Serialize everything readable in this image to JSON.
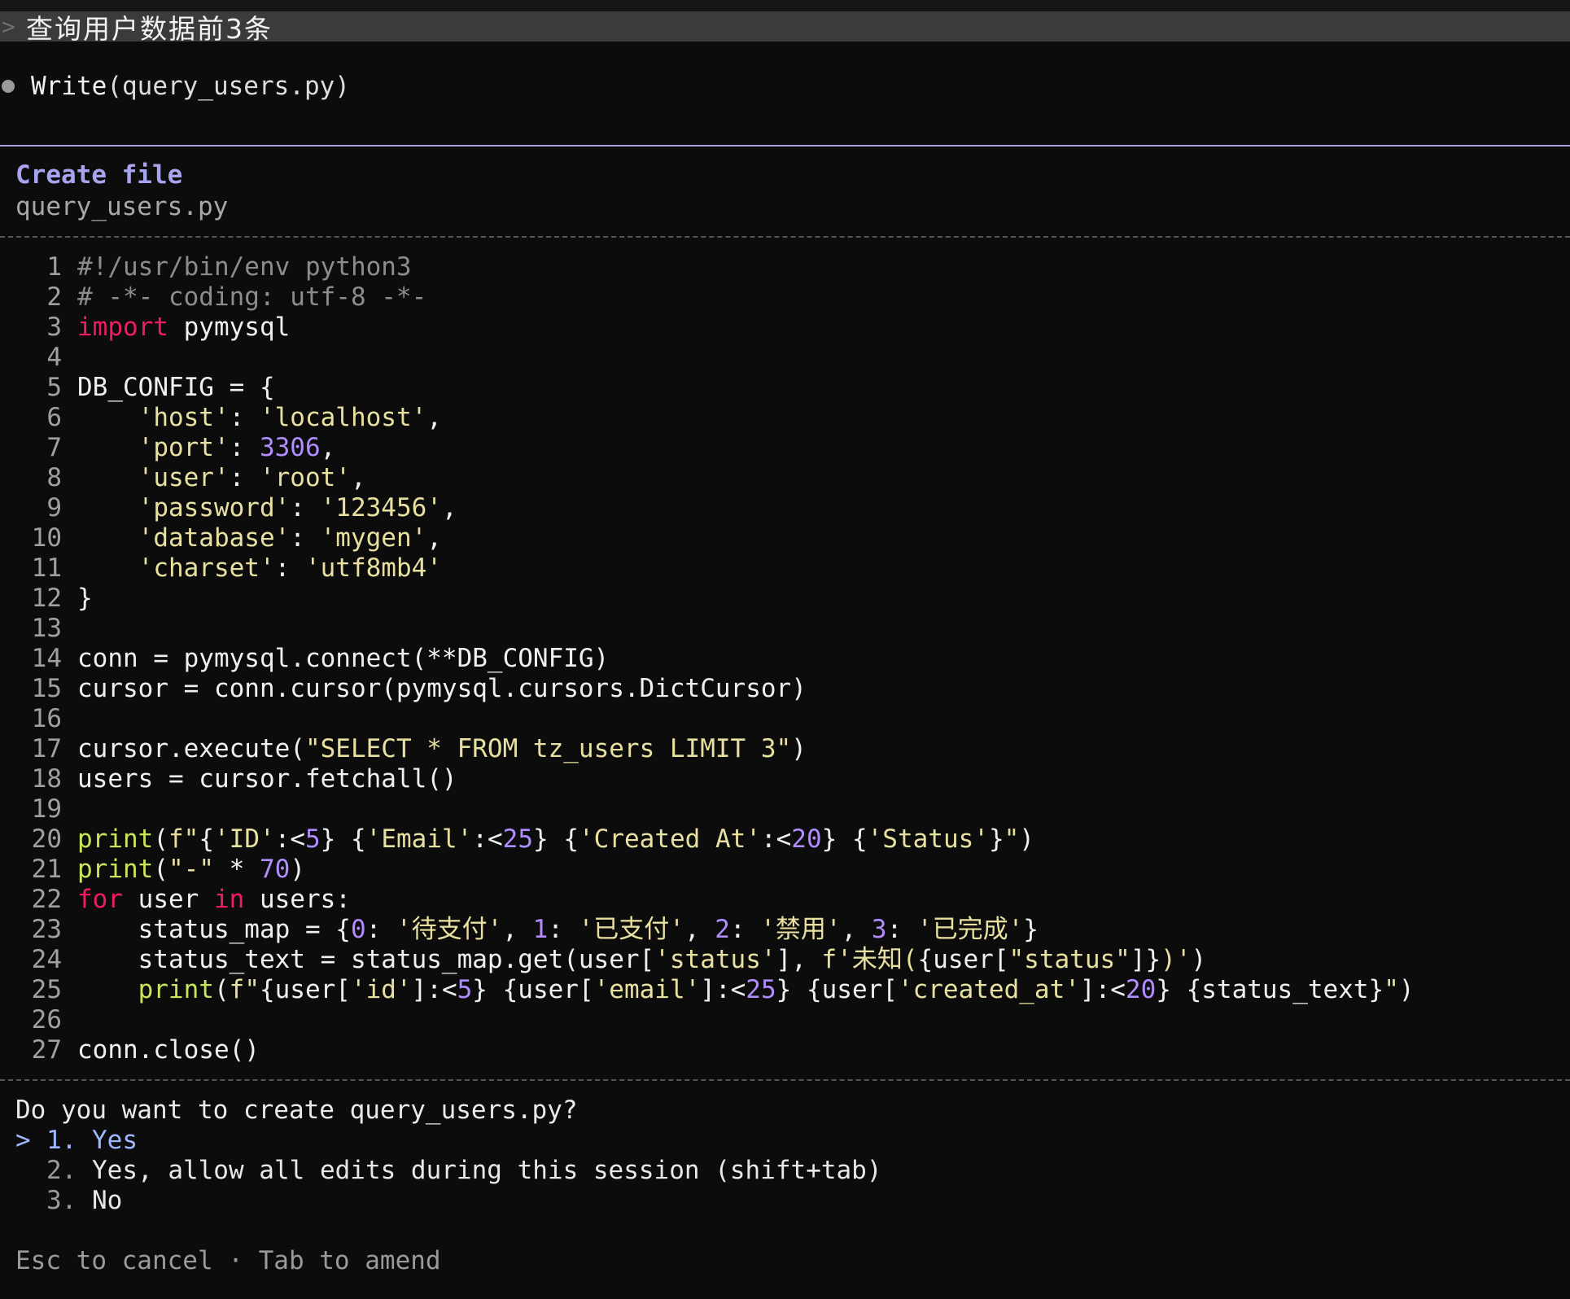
{
  "user_prompt": {
    "caret": ">",
    "message": "查询用户数据前3条"
  },
  "tool_call": {
    "name": "Write",
    "argument": "(query_users.py)"
  },
  "file_panel": {
    "title": "Create file",
    "filename": "query_users.py"
  },
  "code_lines": [
    {
      "n": "1",
      "tokens": [
        {
          "t": "#!/usr/bin/env python3",
          "k": "comment"
        }
      ]
    },
    {
      "n": "2",
      "tokens": [
        {
          "t": "# -*- coding: utf-8 -*-",
          "k": "comment"
        }
      ]
    },
    {
      "n": "3",
      "tokens": [
        {
          "t": "import",
          "k": "keyword"
        },
        {
          "t": " pymysql",
          "k": "plain"
        }
      ]
    },
    {
      "n": "4",
      "tokens": []
    },
    {
      "n": "5",
      "tokens": [
        {
          "t": "DB_CONFIG = {",
          "k": "plain"
        }
      ]
    },
    {
      "n": "6",
      "tokens": [
        {
          "t": "    ",
          "k": "plain"
        },
        {
          "t": "'host'",
          "k": "string"
        },
        {
          "t": ": ",
          "k": "plain"
        },
        {
          "t": "'localhost'",
          "k": "string"
        },
        {
          "t": ",",
          "k": "plain"
        }
      ]
    },
    {
      "n": "7",
      "tokens": [
        {
          "t": "    ",
          "k": "plain"
        },
        {
          "t": "'port'",
          "k": "string"
        },
        {
          "t": ": ",
          "k": "plain"
        },
        {
          "t": "3306",
          "k": "number"
        },
        {
          "t": ",",
          "k": "plain"
        }
      ]
    },
    {
      "n": "8",
      "tokens": [
        {
          "t": "    ",
          "k": "plain"
        },
        {
          "t": "'user'",
          "k": "string"
        },
        {
          "t": ": ",
          "k": "plain"
        },
        {
          "t": "'root'",
          "k": "string"
        },
        {
          "t": ",",
          "k": "plain"
        }
      ]
    },
    {
      "n": "9",
      "tokens": [
        {
          "t": "    ",
          "k": "plain"
        },
        {
          "t": "'password'",
          "k": "string"
        },
        {
          "t": ": ",
          "k": "plain"
        },
        {
          "t": "'123456'",
          "k": "string"
        },
        {
          "t": ",",
          "k": "plain"
        }
      ]
    },
    {
      "n": "10",
      "tokens": [
        {
          "t": "    ",
          "k": "plain"
        },
        {
          "t": "'database'",
          "k": "string"
        },
        {
          "t": ": ",
          "k": "plain"
        },
        {
          "t": "'mygen'",
          "k": "string"
        },
        {
          "t": ",",
          "k": "plain"
        }
      ]
    },
    {
      "n": "11",
      "tokens": [
        {
          "t": "    ",
          "k": "plain"
        },
        {
          "t": "'charset'",
          "k": "string"
        },
        {
          "t": ": ",
          "k": "plain"
        },
        {
          "t": "'utf8mb4'",
          "k": "string"
        }
      ]
    },
    {
      "n": "12",
      "tokens": [
        {
          "t": "}",
          "k": "plain"
        }
      ]
    },
    {
      "n": "13",
      "tokens": []
    },
    {
      "n": "14",
      "tokens": [
        {
          "t": "conn = pymysql.connect(**DB_CONFIG)",
          "k": "plain"
        }
      ]
    },
    {
      "n": "15",
      "tokens": [
        {
          "t": "cursor = conn.cursor(pymysql.cursors.DictCursor)",
          "k": "plain"
        }
      ]
    },
    {
      "n": "16",
      "tokens": []
    },
    {
      "n": "17",
      "tokens": [
        {
          "t": "cursor.execute(",
          "k": "plain"
        },
        {
          "t": "\"SELECT * FROM tz_users LIMIT 3\"",
          "k": "string"
        },
        {
          "t": ")",
          "k": "plain"
        }
      ]
    },
    {
      "n": "18",
      "tokens": [
        {
          "t": "users = cursor.fetchall()",
          "k": "plain"
        }
      ]
    },
    {
      "n": "19",
      "tokens": []
    },
    {
      "n": "20",
      "tokens": [
        {
          "t": "print",
          "k": "builtin"
        },
        {
          "t": "(",
          "k": "plain"
        },
        {
          "t": "f\"",
          "k": "string"
        },
        {
          "t": "{",
          "k": "plain"
        },
        {
          "t": "'ID'",
          "k": "string"
        },
        {
          "t": ":<",
          "k": "plain"
        },
        {
          "t": "5",
          "k": "number"
        },
        {
          "t": "}",
          "k": "plain"
        },
        {
          "t": " ",
          "k": "string"
        },
        {
          "t": "{",
          "k": "plain"
        },
        {
          "t": "'Email'",
          "k": "string"
        },
        {
          "t": ":<",
          "k": "plain"
        },
        {
          "t": "25",
          "k": "number"
        },
        {
          "t": "}",
          "k": "plain"
        },
        {
          "t": " ",
          "k": "string"
        },
        {
          "t": "{",
          "k": "plain"
        },
        {
          "t": "'Created At'",
          "k": "string"
        },
        {
          "t": ":<",
          "k": "plain"
        },
        {
          "t": "20",
          "k": "number"
        },
        {
          "t": "}",
          "k": "plain"
        },
        {
          "t": " ",
          "k": "string"
        },
        {
          "t": "{",
          "k": "plain"
        },
        {
          "t": "'Status'",
          "k": "string"
        },
        {
          "t": "}",
          "k": "plain"
        },
        {
          "t": "\"",
          "k": "string"
        },
        {
          "t": ")",
          "k": "plain"
        }
      ]
    },
    {
      "n": "21",
      "tokens": [
        {
          "t": "print",
          "k": "builtin"
        },
        {
          "t": "(",
          "k": "plain"
        },
        {
          "t": "\"-\"",
          "k": "string"
        },
        {
          "t": " * ",
          "k": "plain"
        },
        {
          "t": "70",
          "k": "number"
        },
        {
          "t": ")",
          "k": "plain"
        }
      ]
    },
    {
      "n": "22",
      "tokens": [
        {
          "t": "for",
          "k": "keyword"
        },
        {
          "t": " user ",
          "k": "plain"
        },
        {
          "t": "in",
          "k": "keyword"
        },
        {
          "t": " users:",
          "k": "plain"
        }
      ]
    },
    {
      "n": "23",
      "tokens": [
        {
          "t": "    status_map = {",
          "k": "plain"
        },
        {
          "t": "0",
          "k": "number"
        },
        {
          "t": ": ",
          "k": "plain"
        },
        {
          "t": "'待支付'",
          "k": "string"
        },
        {
          "t": ", ",
          "k": "plain"
        },
        {
          "t": "1",
          "k": "number"
        },
        {
          "t": ": ",
          "k": "plain"
        },
        {
          "t": "'已支付'",
          "k": "string"
        },
        {
          "t": ", ",
          "k": "plain"
        },
        {
          "t": "2",
          "k": "number"
        },
        {
          "t": ": ",
          "k": "plain"
        },
        {
          "t": "'禁用'",
          "k": "string"
        },
        {
          "t": ", ",
          "k": "plain"
        },
        {
          "t": "3",
          "k": "number"
        },
        {
          "t": ": ",
          "k": "plain"
        },
        {
          "t": "'已完成'",
          "k": "string"
        },
        {
          "t": "}",
          "k": "plain"
        }
      ]
    },
    {
      "n": "24",
      "tokens": [
        {
          "t": "    status_text = status_map.get(user[",
          "k": "plain"
        },
        {
          "t": "'status'",
          "k": "string"
        },
        {
          "t": "], ",
          "k": "plain"
        },
        {
          "t": "f'未知(",
          "k": "string"
        },
        {
          "t": "{user[",
          "k": "plain"
        },
        {
          "t": "\"status\"",
          "k": "string"
        },
        {
          "t": "]}",
          "k": "plain"
        },
        {
          "t": ")'",
          "k": "string"
        },
        {
          "t": ")",
          "k": "plain"
        }
      ]
    },
    {
      "n": "25",
      "tokens": [
        {
          "t": "    ",
          "k": "plain"
        },
        {
          "t": "print",
          "k": "builtin"
        },
        {
          "t": "(",
          "k": "plain"
        },
        {
          "t": "f\"",
          "k": "string"
        },
        {
          "t": "{user[",
          "k": "plain"
        },
        {
          "t": "'id'",
          "k": "string"
        },
        {
          "t": "]:<",
          "k": "plain"
        },
        {
          "t": "5",
          "k": "number"
        },
        {
          "t": "}",
          "k": "plain"
        },
        {
          "t": " ",
          "k": "string"
        },
        {
          "t": "{user[",
          "k": "plain"
        },
        {
          "t": "'email'",
          "k": "string"
        },
        {
          "t": "]:<",
          "k": "plain"
        },
        {
          "t": "25",
          "k": "number"
        },
        {
          "t": "}",
          "k": "plain"
        },
        {
          "t": " ",
          "k": "string"
        },
        {
          "t": "{user[",
          "k": "plain"
        },
        {
          "t": "'created_at'",
          "k": "string"
        },
        {
          "t": "]:<",
          "k": "plain"
        },
        {
          "t": "20",
          "k": "number"
        },
        {
          "t": "}",
          "k": "plain"
        },
        {
          "t": " ",
          "k": "string"
        },
        {
          "t": "{status_text}",
          "k": "plain"
        },
        {
          "t": "\"",
          "k": "string"
        },
        {
          "t": ")",
          "k": "plain"
        }
      ]
    },
    {
      "n": "26",
      "tokens": []
    },
    {
      "n": "27",
      "tokens": [
        {
          "t": "conn.close()",
          "k": "plain"
        }
      ]
    }
  ],
  "confirm": {
    "question": "Do you want to create query_users.py?",
    "caret": ">",
    "options": [
      {
        "num": "1.",
        "label": "Yes",
        "selected": true
      },
      {
        "num": "2.",
        "label": "Yes, allow all edits during this session (shift+tab)",
        "selected": false
      },
      {
        "num": "3.",
        "label": "No",
        "selected": false
      }
    ]
  },
  "footer": {
    "hint": "Esc to cancel · Tab to amend"
  },
  "colors": {
    "keyword": "#f01b66",
    "string": "#e8e0a0",
    "number": "#b08cff",
    "builtin": "#c8e65a",
    "comment": "#8c8c8c",
    "title": "#a9a4f0",
    "selection": "#9fb7ff"
  }
}
